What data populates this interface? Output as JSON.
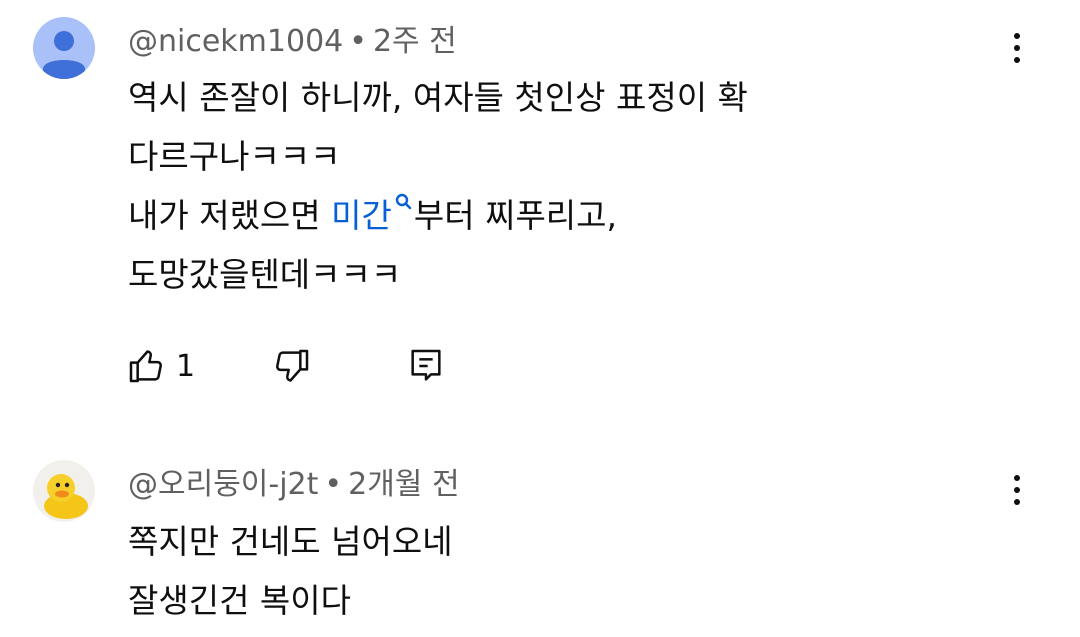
{
  "comments": [
    {
      "handle": "@nicekm1004",
      "separator": "•",
      "time": "2주 전",
      "avatar": "default-person-avatar",
      "lines": {
        "l1": "역시 존잘이 하니까, 여자들 첫인상 표정이 확",
        "l2": "다르구나ㅋㅋㅋ",
        "l3_pre": "내가 저랬으면 ",
        "l3_link": "미간",
        "l3_post": "부터 찌푸리고,",
        "l4": "도망갔을텐데ㅋㅋㅋ"
      },
      "like_count": "1"
    },
    {
      "handle": "@오리둥이-j2t",
      "separator": "•",
      "time": "2개월 전",
      "avatar": "rubber-duck-avatar",
      "lines": {
        "l1": "쪽지만 건네도 넘어오네",
        "l2": "잘생긴건 복이다"
      }
    }
  ],
  "colors": {
    "link": "#065fd4",
    "meta": "#606060",
    "avatar_bg": "#a9c0f8",
    "avatar_fg": "#3f6fd8"
  }
}
